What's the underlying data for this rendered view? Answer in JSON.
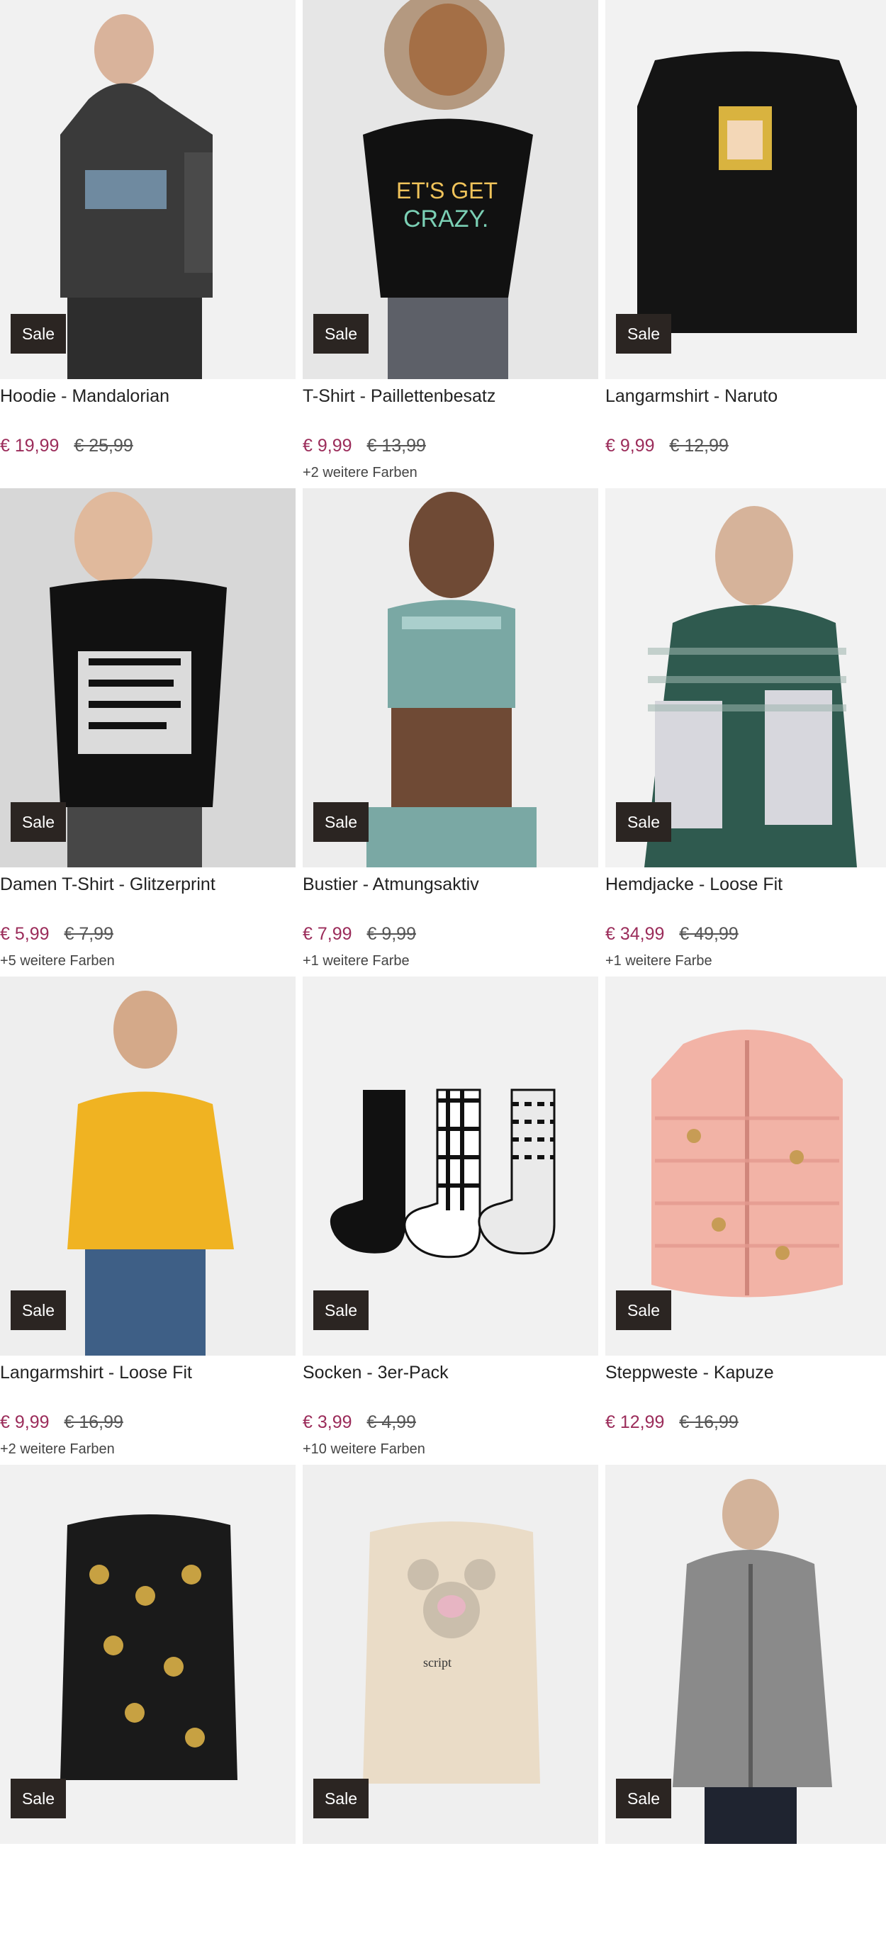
{
  "badge_label": "Sale",
  "colors": {
    "accent": "#9b2c5a",
    "badge_bg": "#2b2522",
    "tile_bg": "#efefef"
  },
  "products": [
    {
      "title": "Hoodie - Mandalorian",
      "price": "€ 19,99",
      "old_price": "€ 25,99",
      "more_colors": "",
      "image": "hoodie-dark",
      "accent": "#2f2f2f"
    },
    {
      "title": "T-Shirt - Paillettenbesatz",
      "price": "€ 9,99",
      "old_price": "€ 13,99",
      "more_colors": "+2 weitere Farben",
      "image": "tshirt-black-woman",
      "accent": "#111111"
    },
    {
      "title": "Langarmshirt - Naruto",
      "price": "€ 9,99",
      "old_price": "€ 12,99",
      "more_colors": "",
      "image": "longsleeve-black",
      "accent": "#151515"
    },
    {
      "title": "Damen T-Shirt - Glitzerprint",
      "price": "€ 5,99",
      "old_price": "€ 7,99",
      "more_colors": "+5 weitere Farben",
      "image": "tshirt-black-woman",
      "accent": "#111111"
    },
    {
      "title": "Bustier - Atmungsaktiv",
      "price": "€ 7,99",
      "old_price": "€ 9,99",
      "more_colors": "+1 weitere Farbe",
      "image": "bustier",
      "accent": "#7aa8a4"
    },
    {
      "title": "Hemdjacke - Loose Fit",
      "price": "€ 34,99",
      "old_price": "€ 49,99",
      "more_colors": "+1 weitere Farbe",
      "image": "plaid-jacket",
      "accent": "#2f5a4f"
    },
    {
      "title": "Langarmshirt - Loose Fit",
      "price": "€ 9,99",
      "old_price": "€ 16,99",
      "more_colors": "+2 weitere Farben",
      "image": "yellow-sweater",
      "accent": "#f0b322"
    },
    {
      "title": "Socken - 3er-Pack",
      "price": "€ 3,99",
      "old_price": "€ 4,99",
      "more_colors": "+10 weitere Farben",
      "image": "socks",
      "accent": "#111111"
    },
    {
      "title": "Steppweste - Kapuze",
      "price": "€ 12,99",
      "old_price": "€ 16,99",
      "more_colors": "",
      "image": "pink-vest",
      "accent": "#f2b3a6"
    },
    {
      "title": "",
      "price": "",
      "old_price": "",
      "more_colors": "",
      "image": "black-print-longsleeve",
      "accent": "#1a1a1a"
    },
    {
      "title": "",
      "price": "",
      "old_price": "",
      "more_colors": "",
      "image": "beige-minnie-longsleeve",
      "accent": "#eadcc7"
    },
    {
      "title": "",
      "price": "",
      "old_price": "",
      "more_colors": "",
      "image": "grey-hoodie",
      "accent": "#8a8a8a"
    }
  ]
}
